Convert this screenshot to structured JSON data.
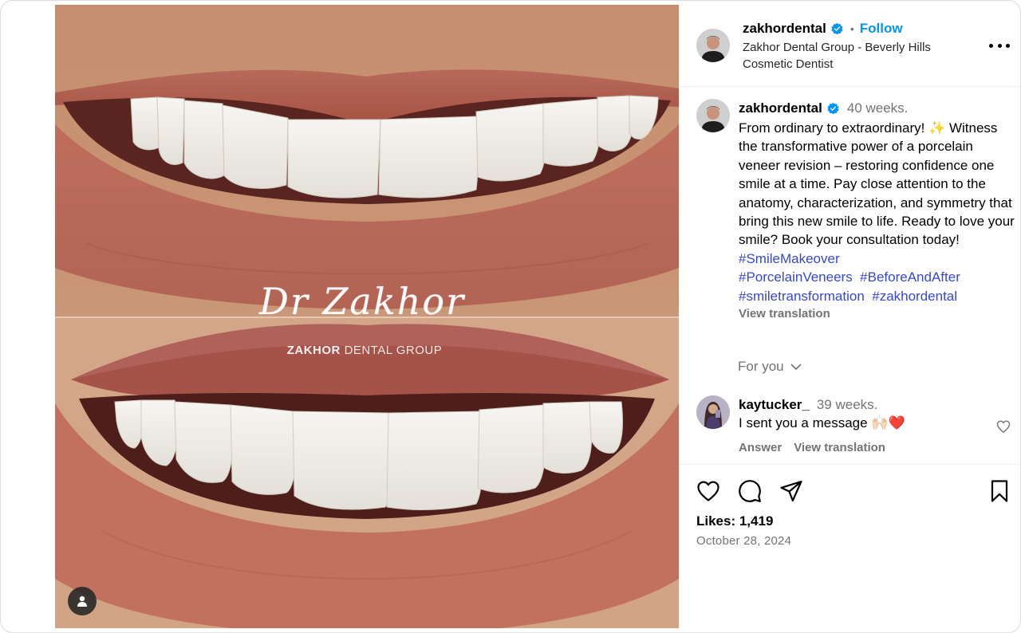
{
  "post": {
    "author": {
      "username": "zakhordental",
      "subtitle_line1": "Zakhor Dental Group - Beverly Hills",
      "subtitle_line2": "Cosmetic Dentist",
      "follow_label": "Follow",
      "dot": "•"
    },
    "media": {
      "watermark_script": "Dr Zakhor",
      "watermark_brand_bold": "ZAKHOR",
      "watermark_brand_light": " DENTAL GROUP"
    },
    "caption": {
      "username": "zakhordental",
      "time": "40 weeks.",
      "text": "From ordinary to extraordinary! ✨ Witness the transformative power of a porcelain veneer revision – restoring confidence one smile at a time. Pay close attention to the anatomy, characterization, and symmetry that bring this new smile to life. Ready to love your smile? Book your consultation today! ",
      "hashtags": [
        "#SmileMakeover",
        "#PorcelainVeneers",
        "#BeforeAndAfter",
        "#smiletransformation",
        "#zakhordental"
      ],
      "view_translation": "View translation"
    },
    "for_you_label": "For you",
    "comment": {
      "username": "kaytucker_",
      "time": "39 weeks.",
      "text": "I sent you a message 🙌🏻❤️",
      "answer_label": "Answer",
      "view_translation": "View translation"
    },
    "likes_text": "Likes: 1,419",
    "date": "October 28, 2024",
    "icons": {
      "verified": "verified-badge-icon",
      "more": "more-options-icon",
      "tag": "user-tag-icon",
      "like": "heart-icon",
      "comment": "comment-icon",
      "share": "share-icon",
      "save": "bookmark-icon",
      "chevron": "chevron-down-icon"
    },
    "colors": {
      "link": "#0095f6",
      "hashtag": "#3747d2",
      "secondary_text": "#737373",
      "verified": "#0095f6"
    }
  }
}
